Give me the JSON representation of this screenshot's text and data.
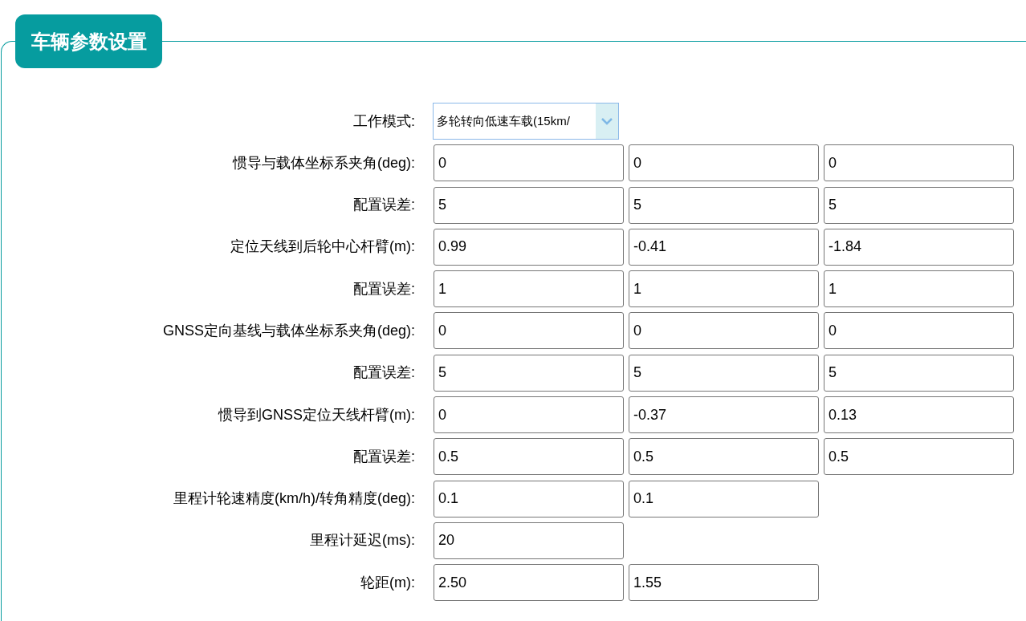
{
  "panel": {
    "title": "车辆参数设置"
  },
  "mode": {
    "label": "工作模式:",
    "value": "多轮转向低速车载(15km/"
  },
  "rows": [
    {
      "label": "惯导与载体坐标系夹角(deg):",
      "values": [
        "0",
        "0",
        "0"
      ]
    },
    {
      "label": "配置误差:",
      "values": [
        "5",
        "5",
        "5"
      ]
    },
    {
      "label": "定位天线到后轮中心杆臂(m):",
      "values": [
        "0.99",
        "-0.41",
        "-1.84"
      ]
    },
    {
      "label": "配置误差:",
      "values": [
        "1",
        "1",
        "1"
      ]
    },
    {
      "label": "GNSS定向基线与载体坐标系夹角(deg):",
      "values": [
        "0",
        "0",
        "0"
      ]
    },
    {
      "label": "配置误差:",
      "values": [
        "5",
        "5",
        "5"
      ]
    },
    {
      "label": "惯导到GNSS定位天线杆臂(m):",
      "values": [
        "0",
        "-0.37",
        "0.13"
      ]
    },
    {
      "label": "配置误差:",
      "values": [
        "0.5",
        "0.5",
        "0.5"
      ]
    },
    {
      "label": "里程计轮速精度(km/h)/转角精度(deg):",
      "values": [
        "0.1",
        "0.1"
      ]
    },
    {
      "label": "里程计延迟(ms):",
      "values": [
        "20"
      ]
    },
    {
      "label": "轮距(m):",
      "values": [
        "2.50",
        "1.55"
      ]
    }
  ]
}
